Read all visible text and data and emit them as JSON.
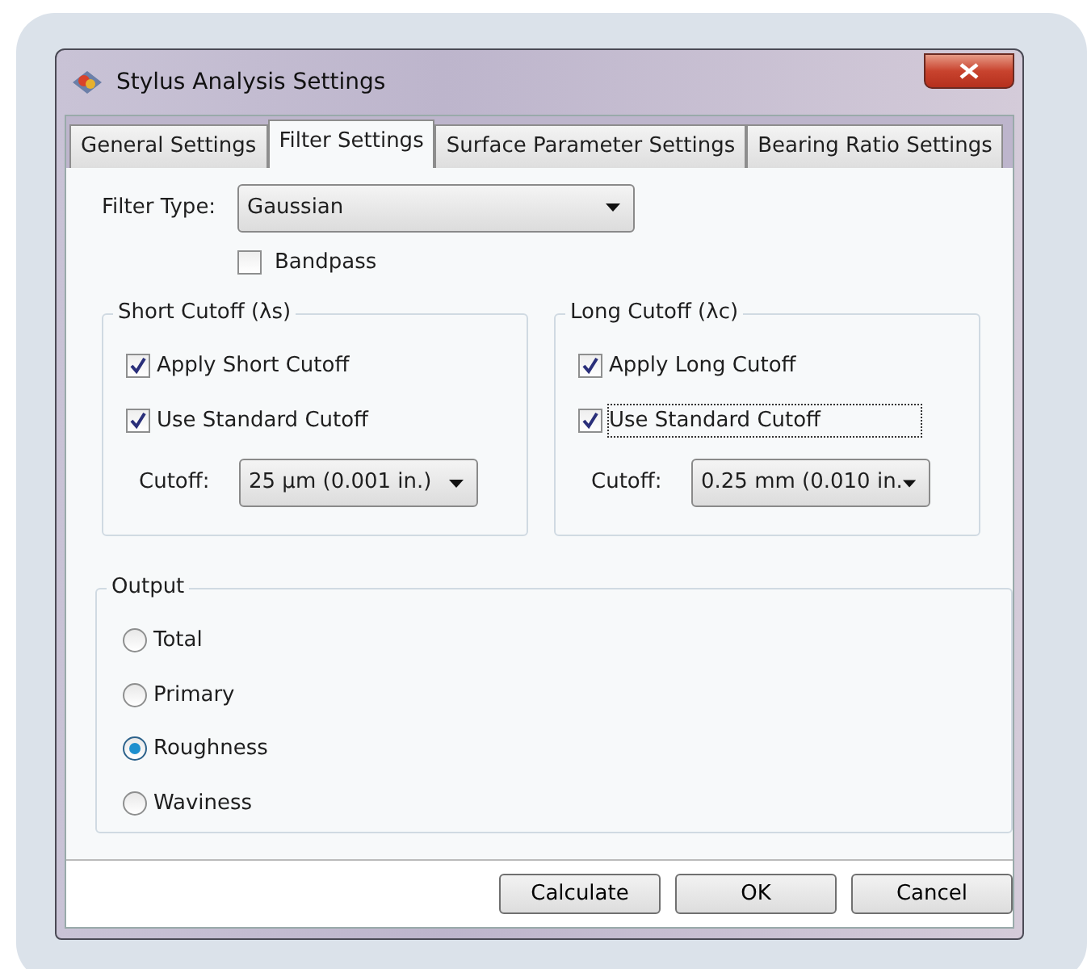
{
  "window": {
    "title": "Stylus Analysis Settings"
  },
  "tabs": [
    {
      "label": "General Settings",
      "selected": false
    },
    {
      "label": "Filter Settings",
      "selected": true
    },
    {
      "label": "Surface Parameter Settings",
      "selected": false
    },
    {
      "label": "Bearing Ratio Settings",
      "selected": false
    }
  ],
  "filter_type": {
    "label": "Filter Type:",
    "value": "Gaussian"
  },
  "bandpass": {
    "label": "Bandpass",
    "checked": false
  },
  "cutoff_groups": [
    {
      "title": "Short Cutoff (λs)",
      "options": [
        {
          "label": "Apply Short Cutoff",
          "checked": true,
          "focused": false
        },
        {
          "label": "Use Standard Cutoff",
          "checked": true,
          "focused": false
        }
      ],
      "cutoff": {
        "label": "Cutoff:",
        "value": "25 µm (0.001 in.)"
      }
    },
    {
      "title": "Long Cutoff (λc)",
      "options": [
        {
          "label": "Apply Long Cutoff",
          "checked": true,
          "focused": false
        },
        {
          "label": "Use Standard Cutoff",
          "checked": true,
          "focused": true
        }
      ],
      "cutoff": {
        "label": "Cutoff:",
        "value": "0.25 mm (0.010 in."
      }
    }
  ],
  "output": {
    "title": "Output",
    "options": [
      {
        "label": "Total",
        "selected": false
      },
      {
        "label": "Primary",
        "selected": false
      },
      {
        "label": "Roughness",
        "selected": true
      },
      {
        "label": "Waviness",
        "selected": false
      }
    ]
  },
  "buttons": [
    "Calculate",
    "OK",
    "Cancel"
  ]
}
